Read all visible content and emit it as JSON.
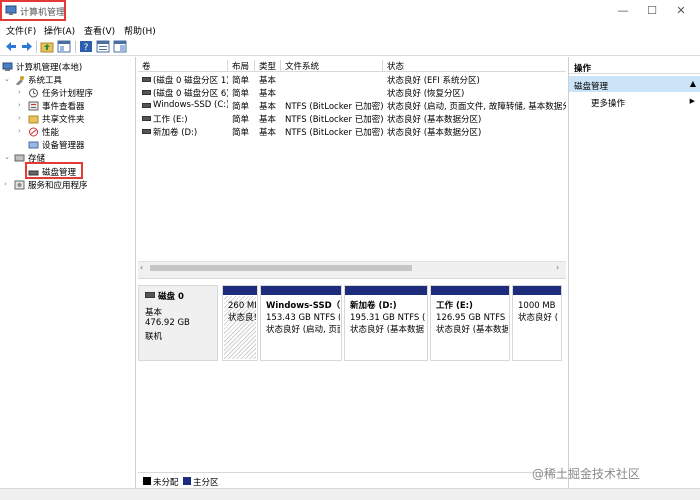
{
  "window": {
    "title": "计算机管理",
    "minimize": "—",
    "maximize": "☐",
    "close": "✕"
  },
  "menu": [
    "文件(F)",
    "操作(A)",
    "查看(V)",
    "帮助(H)"
  ],
  "tree": {
    "root": "计算机管理(本地)",
    "system_tools": "系统工具",
    "task_scheduler": "任务计划程序",
    "event_viewer": "事件查看器",
    "shared_folders": "共享文件夹",
    "performance": "性能",
    "device_manager": "设备管理器",
    "storage": "存储",
    "disk_management": "磁盘管理",
    "services_apps": "服务和应用程序"
  },
  "columns": [
    "卷",
    "布局",
    "类型",
    "文件系统",
    "状态"
  ],
  "volumes": [
    {
      "name": "(磁盘 0 磁盘分区 1)",
      "layout": "简单",
      "type": "基本",
      "fs": "",
      "status": "状态良好 (EFI 系统分区)"
    },
    {
      "name": "(磁盘 0 磁盘分区 6)",
      "layout": "简单",
      "type": "基本",
      "fs": "",
      "status": "状态良好 (恢复分区)"
    },
    {
      "name": "Windows-SSD (C:)",
      "layout": "简单",
      "type": "基本",
      "fs": "NTFS (BitLocker 已加密)",
      "status": "状态良好 (启动, 页面文件, 故障转储, 基本数据分"
    },
    {
      "name": "工作 (E:)",
      "layout": "简单",
      "type": "基本",
      "fs": "NTFS (BitLocker 已加密)",
      "status": "状态良好 (基本数据分区)"
    },
    {
      "name": "新加卷 (D:)",
      "layout": "简单",
      "type": "基本",
      "fs": "NTFS (BitLocker 已加密)",
      "status": "状态良好 (基本数据分区)"
    }
  ],
  "disk": {
    "title": "磁盘 0",
    "type": "基本",
    "size": "476.92 GB",
    "state": "联机"
  },
  "partitions": [
    {
      "name": "",
      "size": "260 MI",
      "status": "状态良!"
    },
    {
      "name": "Windows-SSD（C",
      "size": "153.43 GB NTFS (E",
      "status": "状态良好 (启动, 页面"
    },
    {
      "name": "新加卷  (D:)",
      "size": "195.31 GB NTFS (BitLo",
      "status": "状态良好 (基本数据"
    },
    {
      "name": "工作  (E:)",
      "size": "126.95 GB NTFS (BitLo",
      "status": "状态良好 (基本数据"
    },
    {
      "name": "",
      "size": "1000 MB",
      "status": "状态良好 ("
    }
  ],
  "legend": {
    "unallocated": "未分配",
    "primary": "主分区",
    "unallocated_color": "#000000",
    "primary_color": "#1e2c7e"
  },
  "actions": {
    "header": "操作",
    "section": "磁盘管理",
    "more": "更多操作"
  },
  "watermark": "@稀土掘金技术社区",
  "colors": {
    "highlight": "#e53935",
    "partition_bar": "#1e2c7e",
    "selection": "#cce4f7"
  }
}
